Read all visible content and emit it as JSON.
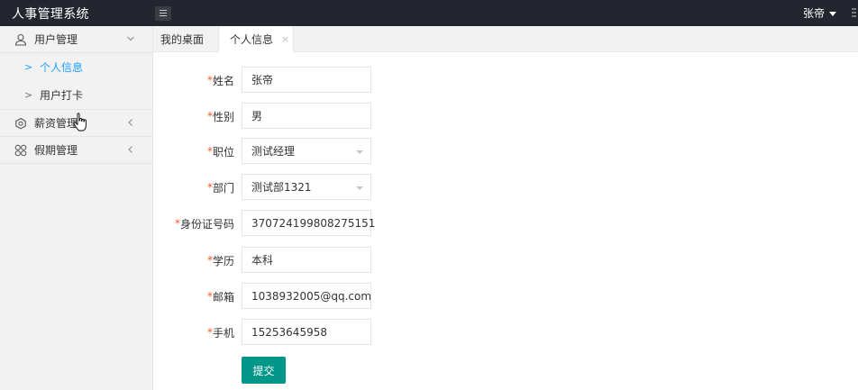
{
  "header": {
    "logo_text": "人事管理系统",
    "user_name": "张帝"
  },
  "sidebar": {
    "groups": [
      {
        "label": "用户管理",
        "icon": "user-icon",
        "expanded": true,
        "items": [
          {
            "label": "个人信息",
            "active": true
          },
          {
            "label": "用户打卡",
            "active": false
          }
        ]
      },
      {
        "label": "薪资管理",
        "icon": "salary-icon",
        "expanded": false
      },
      {
        "label": "假期管理",
        "icon": "grid-icon",
        "expanded": false
      }
    ]
  },
  "tabs": [
    {
      "label": "我的桌面",
      "closable": false
    },
    {
      "label": "个人信息",
      "closable": true,
      "close_symbol": "×"
    }
  ],
  "form": {
    "fields": [
      {
        "label": "姓名",
        "value": "张帝",
        "type": "text"
      },
      {
        "label": "性别",
        "value": "男",
        "type": "text"
      },
      {
        "label": "职位",
        "value": "测试经理",
        "type": "select"
      },
      {
        "label": "部门",
        "value": "测试部1321",
        "type": "select"
      },
      {
        "label": "身份证号码",
        "value": "370724199808275151",
        "type": "text"
      },
      {
        "label": "学历",
        "value": "本科",
        "type": "text"
      },
      {
        "label": "邮箱",
        "value": "1038932005@qq.com",
        "type": "text"
      },
      {
        "label": "手机",
        "value": "15253645958",
        "type": "text"
      }
    ],
    "required_mark": "*",
    "submit_label": "提交"
  },
  "colors": {
    "header_bg": "#23262e",
    "sidebar_bg": "#f2f2f2",
    "active_link": "#1e9fff",
    "required": "#ff5722",
    "submit_bg": "#009688"
  }
}
